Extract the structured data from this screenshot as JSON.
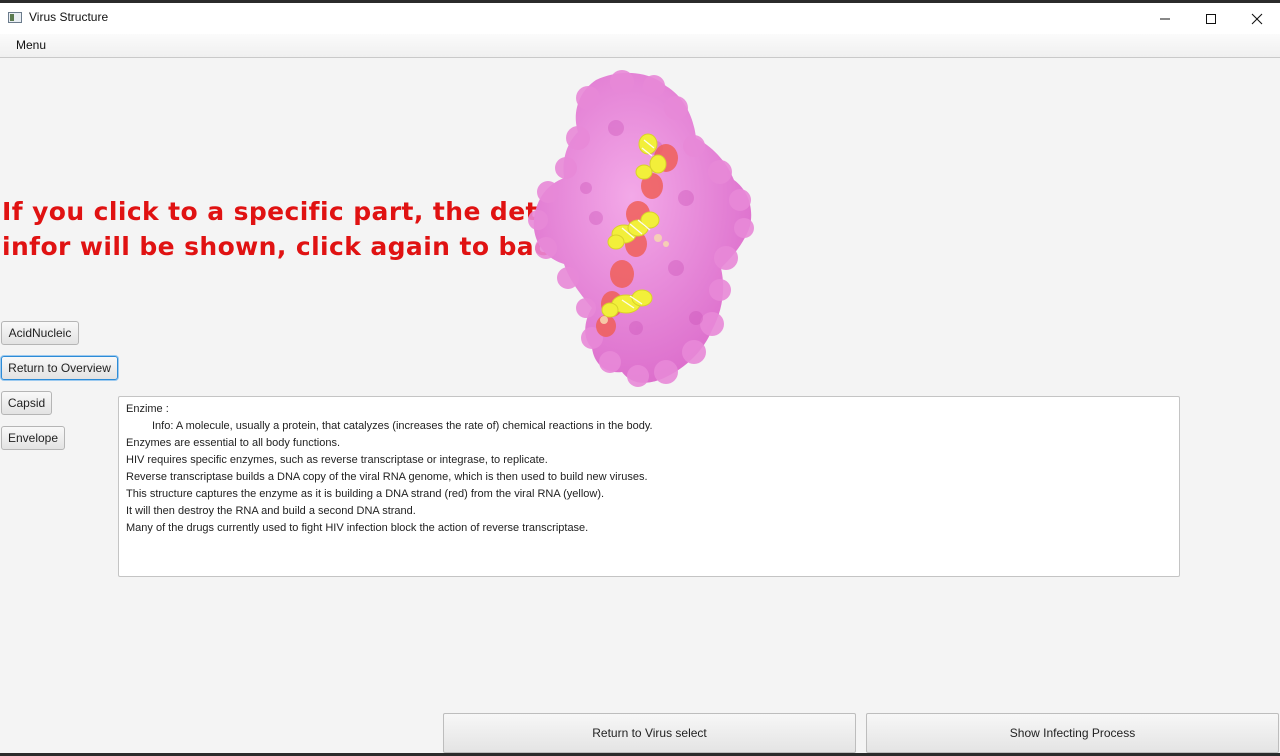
{
  "window": {
    "title": "Virus Structure",
    "icons": {
      "app": "app-window-icon",
      "minimize": "minimize-icon",
      "maximize": "maximize-icon",
      "close": "close-icon"
    }
  },
  "menubar": {
    "menu_label": "Menu"
  },
  "annotation": {
    "line1": "If you click to a specific part, the detail",
    "line2": "infor will be shown, click again to back",
    "color": "#e01212"
  },
  "parts": {
    "acid_nucleic": "AcidNucleic",
    "return_overview": "Return to Overview",
    "capsid": "Capsid",
    "envelope": "Envelope"
  },
  "info": {
    "heading": "Enzime :",
    "lines": [
      "Info: A molecule, usually a protein, that catalyzes (increases the rate of) chemical reactions in the body.",
      "Enzymes are essential to all body functions.",
      "HIV requires specific enzymes, such as reverse transcriptase or integrase, to replicate.",
      "Reverse transcriptase builds a DNA copy of the viral RNA genome, which is then used to build new viruses.",
      "This structure captures the enzyme as it is building a DNA strand (red) from the viral RNA (yellow).",
      "It will then destroy the RNA and build a second DNA strand.",
      "Many of the drugs currently used to fight HIV infection block the action of reverse transcriptase."
    ]
  },
  "footer": {
    "return_virus": "Return to Virus select",
    "show_process": "Show Infecting Process"
  },
  "colors": {
    "protein": "#e47fd6",
    "dna": "#f0605a",
    "rna": "#f2ef3a",
    "focus": "#2d8bd6"
  }
}
